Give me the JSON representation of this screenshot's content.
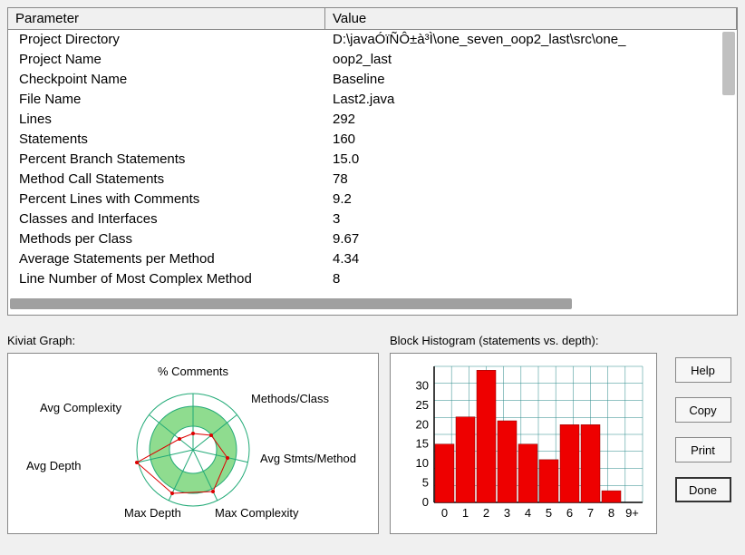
{
  "table": {
    "headers": {
      "param": "Parameter",
      "value": "Value"
    },
    "rows": [
      {
        "param": "Project Directory",
        "value": "D:\\javaÓïÑÔ±à³Ì\\one_seven_oop2_last\\src\\one_"
      },
      {
        "param": "Project Name",
        "value": "oop2_last"
      },
      {
        "param": "Checkpoint Name",
        "value": "Baseline"
      },
      {
        "param": "File Name",
        "value": "Last2.java"
      },
      {
        "param": "Lines",
        "value": "292"
      },
      {
        "param": "Statements",
        "value": "160"
      },
      {
        "param": "Percent Branch Statements",
        "value": "15.0"
      },
      {
        "param": "Method Call Statements",
        "value": "78"
      },
      {
        "param": "Percent Lines with Comments",
        "value": "9.2"
      },
      {
        "param": "Classes and Interfaces",
        "value": "3"
      },
      {
        "param": "Methods per Class",
        "value": "9.67"
      },
      {
        "param": "Average Statements per Method",
        "value": "4.34"
      },
      {
        "param": "Line Number of Most Complex Method",
        "value": "8"
      }
    ]
  },
  "kiviat": {
    "title": "Kiviat Graph:",
    "axes": [
      "% Comments",
      "Methods/Class",
      "Avg Stmts/Method",
      "Max Complexity",
      "Max Depth",
      "Avg Depth",
      "Avg Complexity"
    ]
  },
  "histogram": {
    "title": "Block Histogram (statements vs. depth):"
  },
  "chart_data": {
    "type": "bar",
    "categories": [
      "0",
      "1",
      "2",
      "3",
      "4",
      "5",
      "6",
      "7",
      "8",
      "9+"
    ],
    "values": [
      15,
      22,
      34,
      21,
      15,
      11,
      20,
      20,
      3,
      0
    ],
    "xlabel": "depth",
    "ylabel": "statements",
    "ylim": [
      0,
      35
    ],
    "yticks": [
      0,
      5,
      10,
      15,
      20,
      25,
      30
    ]
  },
  "buttons": {
    "help": "Help",
    "copy": "Copy",
    "print": "Print",
    "done": "Done"
  }
}
